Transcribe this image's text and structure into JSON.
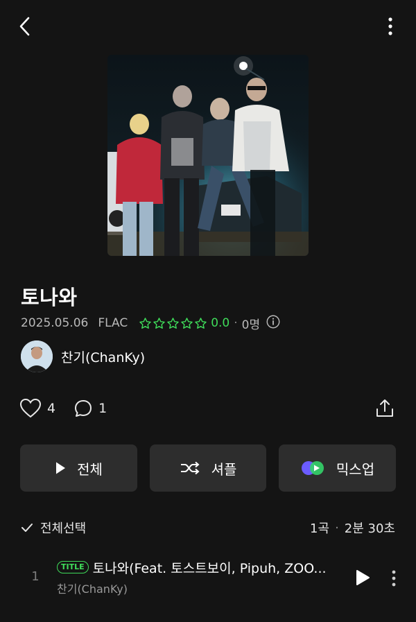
{
  "album": {
    "title": "토나와",
    "date": "2025.05.06",
    "format": "FLAC",
    "rating": "0.0",
    "rating_count": "0명",
    "star_color": "#3fdc5a"
  },
  "artist": {
    "name": "찬기(ChanKy)"
  },
  "stats": {
    "likes": "4",
    "comments": "1"
  },
  "buttons": {
    "play_all": "전체",
    "shuffle": "셔플",
    "mixup": "믹스업"
  },
  "list": {
    "select_all": "전체선택",
    "count": "1곡",
    "duration": "2분 30초"
  },
  "tracks": [
    {
      "number": "1",
      "badge": "TITLE",
      "title": "토나와(Feat. 토스트보이, Pipuh, ZOO...",
      "artist": "찬기(ChanKy)"
    }
  ],
  "icons": [
    "back-icon",
    "more-icon",
    "star-icon",
    "info-icon",
    "heart-icon",
    "comment-icon",
    "share-icon",
    "play-icon",
    "shuffle-icon",
    "mixup-icon",
    "check-icon"
  ]
}
